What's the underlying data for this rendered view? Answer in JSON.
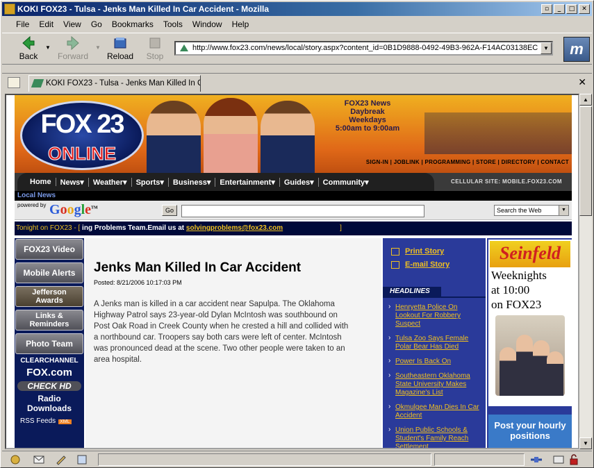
{
  "window": {
    "title": "KOKI FOX23 - Tulsa - Jenks Man Killed In Car Accident - Mozilla"
  },
  "menu": [
    "File",
    "Edit",
    "View",
    "Go",
    "Bookmarks",
    "Tools",
    "Window",
    "Help"
  ],
  "nav": {
    "back": "Back",
    "forward": "Forward",
    "reload": "Reload",
    "stop": "Stop",
    "url": "http://www.fox23.com/news/local/story.aspx?content_id=0B1D9888-0492-49B3-962A-F14AC03138EC"
  },
  "tab": {
    "label": "KOKI FOX23 - Tulsa - Jenks Man Killed In C..."
  },
  "site": {
    "logo_top": "FOX 23",
    "logo_bottom": "ONLINE",
    "promo_line1": "FOX23 News",
    "promo_line2": "Daybreak",
    "promo_line3": "Weekdays",
    "promo_line4": "5:00am to 9:00am",
    "top_links": "SIGN-IN | JOBLINK | PROGRAMMING | STORE | DIRECTORY | CONTACT",
    "nav_items": [
      "Home",
      "News▾",
      "Weather▾",
      "Sports▾",
      "Business▾",
      "Entertainment▾",
      "Guides▾",
      "Community▾"
    ],
    "cellular": "CELLULAR SITE: MOBILE.FOX23.COM",
    "local_news": "Local News",
    "powered_by": "powered by",
    "google_tm": "TM",
    "go": "Go",
    "search_scope": "Search the Web",
    "ticker_label": "Tonight on FOX23 - [",
    "ticker_text": " ing Problems Team.Email us at ",
    "ticker_email": "solvingproblems@fox23.com",
    "ticker_close": "]"
  },
  "left_nav": {
    "video": "FOX23 Video",
    "mobile": "Mobile Alerts",
    "jefferson_1": "Jefferson",
    "jefferson_2": "Awards",
    "links_1": "Links &",
    "links_2": "Reminders",
    "photo": "Photo Team",
    "clearchannel": "CLEARCHANNEL",
    "foxcom": "FOX.com",
    "checkhd": "CHECK HD",
    "radio": "Radio Downloads",
    "rss": "RSS Feeds",
    "xml": "XML"
  },
  "article": {
    "title": "Jenks Man Killed In Car Accident",
    "posted": "Posted: 8/21/2006 10:17:03 PM",
    "body": "A Jenks man is killed in a car accident near Sapulpa. The Oklahoma Highway Patrol says 23-year-old Dylan McIntosh was southbound on Post Oak Road in Creek County when he crested a hill and collided with a northbound car. Troopers say both cars were left of center. McIntosh was pronounced dead at the scene. Two other people were taken to an area hospital."
  },
  "tools": {
    "print": "Print Story",
    "email": "E-mail Story"
  },
  "headlines": {
    "label": "HEADLINES",
    "items": [
      "Henryetta Police On Lookout For Robbery Suspect",
      "Tulsa Zoo Says Female Polar Bear Has Died",
      "Power Is Back On",
      "Southeastern Oklahoma State University Makes Magazine's List",
      "Okmulgee Man Dies In Car Accident",
      "Union Public Schools & Student's Family Reach Settlement"
    ]
  },
  "ad": {
    "title": "Seinfeld",
    "line1": "Weeknights",
    "line2": "at 10:00",
    "line3": "on FOX23",
    "hourly": "Post your hourly positions"
  }
}
